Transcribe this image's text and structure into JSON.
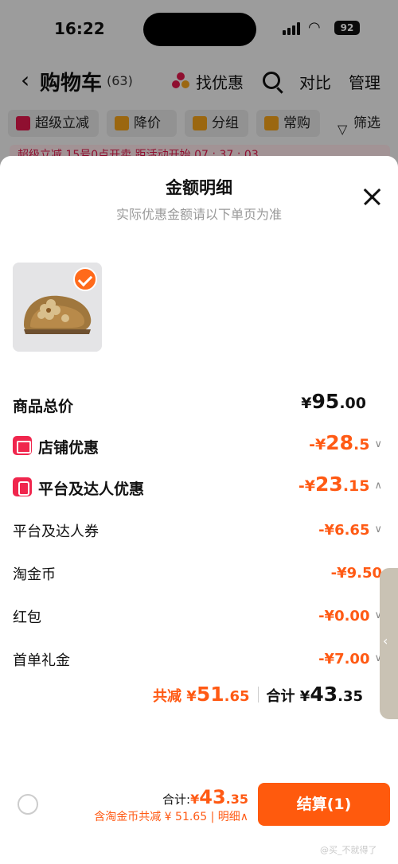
{
  "status_bar": {
    "time": "16:22",
    "battery": "92"
  },
  "nav": {
    "back_icon": "chevron-left-icon",
    "title": "购物车",
    "count": "(63)",
    "find_deals": "找优惠",
    "compare": "对比",
    "manage": "管理"
  },
  "chips": [
    {
      "label": "超级立减",
      "icon": "arrow-down-icon",
      "color": "#e0184b"
    },
    {
      "label": "降价",
      "icon": "arrow-down-icon",
      "color": "#f2a11a"
    },
    {
      "label": "分组",
      "icon": "folder-icon",
      "color": "#f2a11a"
    },
    {
      "label": "常购",
      "icon": "bag-icon",
      "color": "#f2a11a"
    }
  ],
  "filter": "筛选",
  "promo_strip": "超级立减 15号0点开卖 距活动开始 07 : 37 : 03",
  "sheet": {
    "title": "金额明细",
    "subtitle": "实际优惠金额请以下单页为准",
    "rows": {
      "total_price": {
        "label": "商品总价",
        "currency": "¥",
        "int": "95",
        "dec": ".00"
      },
      "store_discount": {
        "label": "店铺优惠",
        "prefix": "-¥",
        "int": "28",
        "dec": ".5"
      },
      "platform_discount": {
        "label": "平台及达人优惠",
        "prefix": "-¥",
        "int": "23",
        "dec": ".15"
      },
      "coupon": {
        "label": "平台及达人券",
        "value": "-¥6.65"
      },
      "taojinbi": {
        "label": "淘金币",
        "value": "-¥9.50"
      },
      "hongbao": {
        "label": "红包",
        "value": "-¥0.00"
      },
      "first_order": {
        "label": "首单礼金",
        "value": "-¥7.00"
      }
    },
    "summary": {
      "saved_label": "共减",
      "saved_currency": "¥",
      "saved_int": "51",
      "saved_dec": ".65",
      "total_label": "合计",
      "total_currency": "¥",
      "total_int": "43",
      "total_dec": ".35"
    }
  },
  "footer": {
    "sum_label": "合计:",
    "sum_currency": "¥",
    "sum_int": "43",
    "sum_dec": ".35",
    "sub_text": "含淘金币共减 ¥ 51.65 | 明细",
    "checkout": "结算(1)"
  },
  "watermark": "@买_不就得了",
  "colors": {
    "accent": "#ff5a14",
    "badge": "#f0264d"
  }
}
